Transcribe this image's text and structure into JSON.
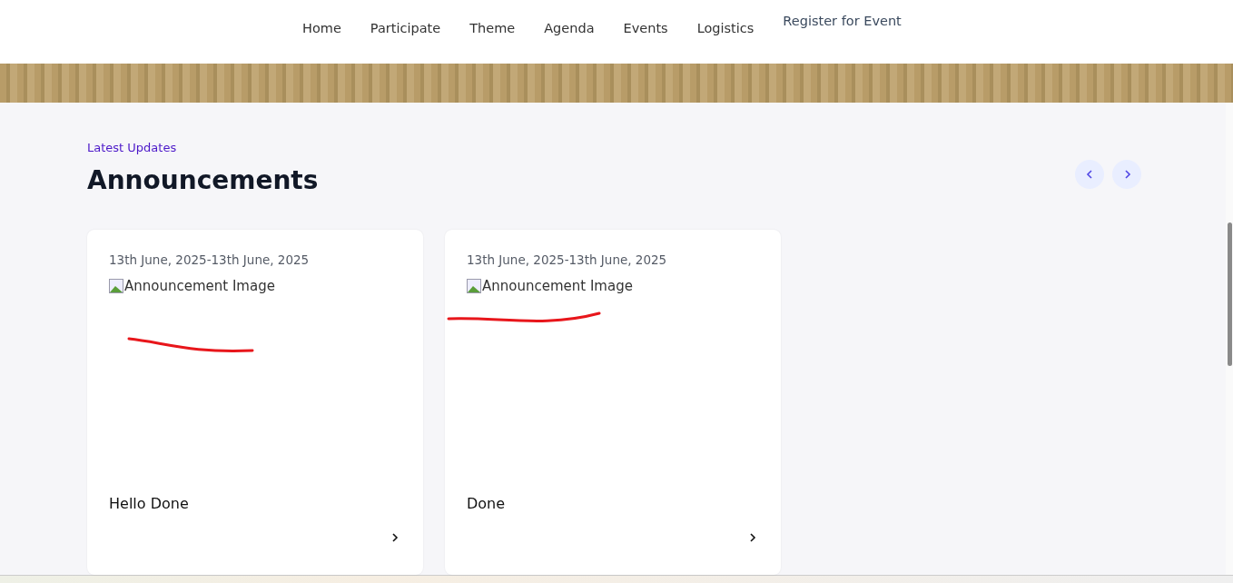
{
  "nav": {
    "items": [
      {
        "label": "Home",
        "kind": "link"
      },
      {
        "label": "Participate",
        "kind": "link"
      },
      {
        "label": "Theme",
        "kind": "link"
      },
      {
        "label": "Agenda",
        "kind": "link"
      },
      {
        "label": "Events",
        "kind": "link"
      },
      {
        "label": "Logistics",
        "kind": "link"
      },
      {
        "label": "Register for Event",
        "kind": "cta"
      }
    ]
  },
  "section": {
    "eyebrow": "Latest Updates",
    "title": "Announcements",
    "carousel_buttons": [
      {
        "kind": "prev"
      },
      {
        "kind": "next"
      }
    ]
  },
  "cards": [
    {
      "date": "13th June, 2025-13th June, 2025",
      "image_alt": "Announcement Image",
      "title": "Hello Done"
    },
    {
      "date": "13th June, 2025-13th June, 2025",
      "image_alt": "Announcement Image",
      "title": "Done"
    }
  ]
}
